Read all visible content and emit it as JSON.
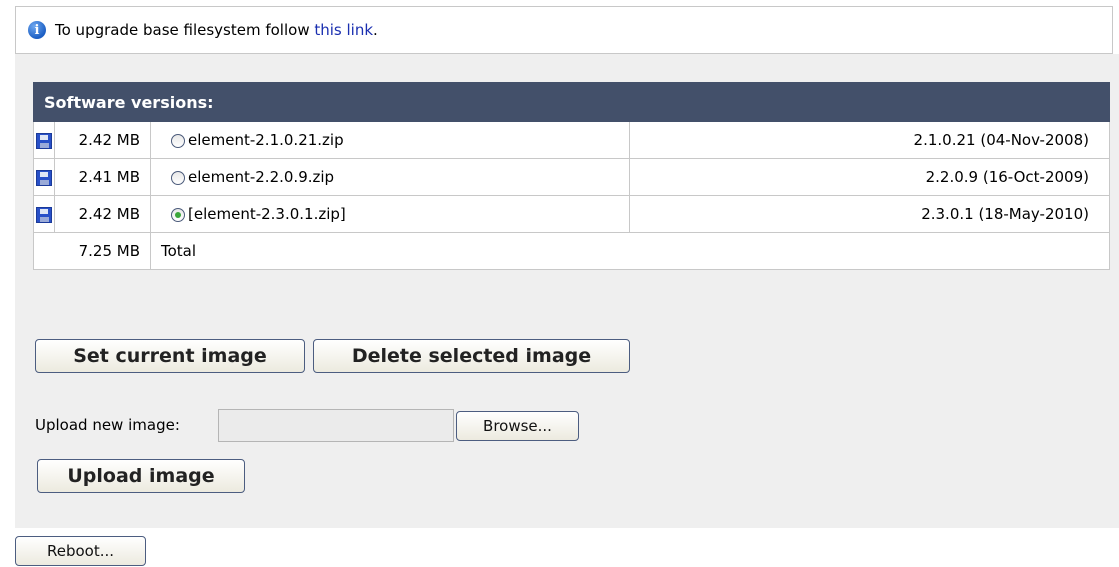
{
  "notice": {
    "icon": "info-icon",
    "text_before": "To upgrade base filesystem follow ",
    "link_text": "this link",
    "text_after": "."
  },
  "table": {
    "header": "Software versions:",
    "rows": [
      {
        "size": "2.42 MB",
        "file": "element-2.1.0.21.zip",
        "version": "2.1.0.21 (04-Nov-2008)",
        "selected": false
      },
      {
        "size": "2.41 MB",
        "file": "element-2.2.0.9.zip",
        "version": "2.2.0.9 (16-Oct-2009)",
        "selected": false
      },
      {
        "size": "2.42 MB",
        "file": "[element-2.3.0.1.zip]",
        "version": "2.3.0.1 (18-May-2010)",
        "selected": true
      }
    ],
    "total_size": "7.25 MB",
    "total_label": "Total"
  },
  "buttons": {
    "set_current": "Set current image",
    "delete_selected": "Delete selected image",
    "upload": "Upload image",
    "browse": "Browse...",
    "reboot": "Reboot..."
  },
  "upload": {
    "label": "Upload new image:",
    "value": ""
  },
  "colors": {
    "header_bg": "#43506a",
    "panel_bg": "#efefef",
    "link": "#1a2fb0"
  }
}
